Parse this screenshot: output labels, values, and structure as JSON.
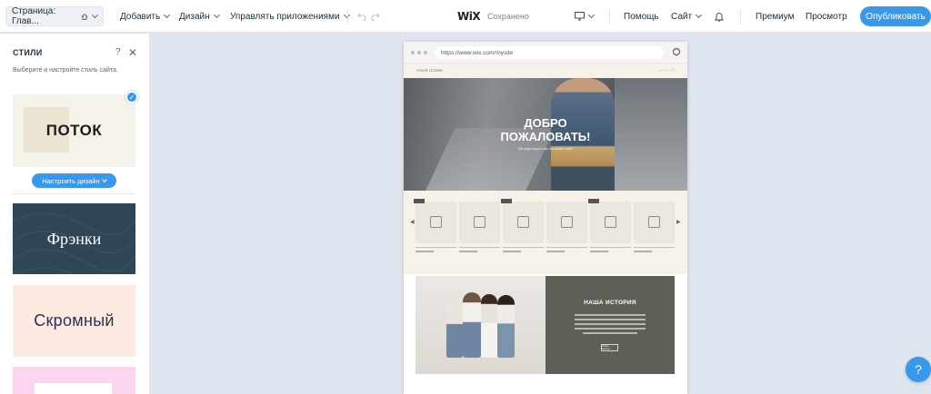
{
  "topbar": {
    "page_selector": "Страница: Глав...",
    "menu": [
      "Добавить",
      "Дизайн",
      "Управлять приложениями"
    ],
    "logo": "WiX",
    "saved_status": "Сохранено",
    "help": "Помощь",
    "site": "Сайт",
    "premium": "Премиум",
    "preview": "Просмотр",
    "publish": "Опубликовать"
  },
  "panel": {
    "title": "СТИЛИ",
    "help_icon": "?",
    "close_icon": "✕",
    "subtitle": "Выберите и настройте стиль сайта.",
    "customize_button": "Настроить дизайн",
    "styles": [
      {
        "name": "ПОТОК",
        "selected": true
      },
      {
        "name": "Фрэнки"
      },
      {
        "name": "Скромный"
      }
    ]
  },
  "preview": {
    "url": "https://www.wix.com/mysite",
    "site_logo": "YOUR STORE",
    "hero_title": "ДОБРО\nПОЖАЛОВАТЬ!",
    "hero_subtitle": "Мы рады видеть вас на нашем сайте",
    "story_title": "НАША ИСТОРИЯ",
    "story_button": "Узнать больше"
  },
  "help_fab": "?",
  "colors": {
    "accent": "#3899ec",
    "canvas_bg": "#dfe5ee"
  }
}
